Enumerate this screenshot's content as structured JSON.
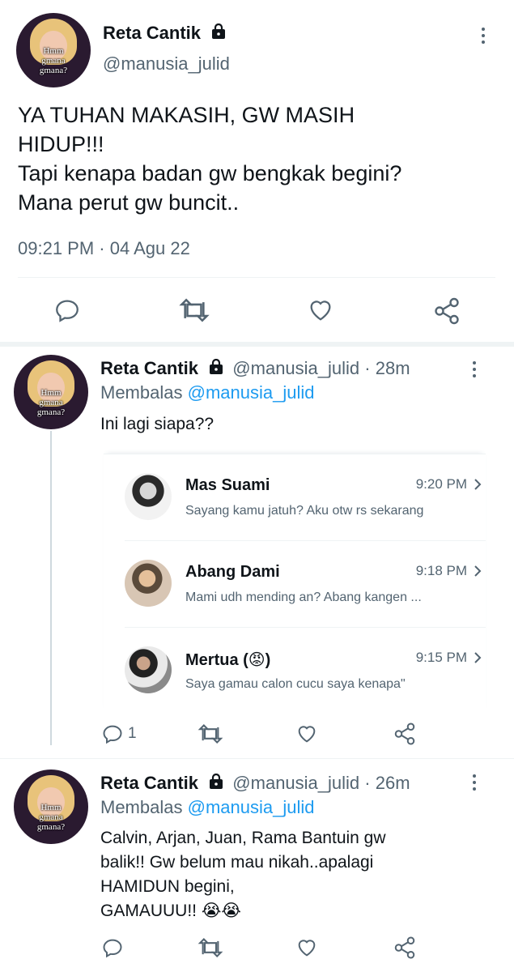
{
  "main_tweet": {
    "author_name": "Reta Cantik",
    "handle": "@manusia_julid",
    "avatar_caption": "Hmm gmana gmana?",
    "text_lines": [
      "YA TUHAN MAKASIH, GW MASIH",
      "HIDUP!!!",
      "Tapi kenapa badan gw bengkak begini?",
      "Mana perut gw buncit.."
    ],
    "timestamp": "09:21 PM · 04 Agu 22"
  },
  "reply1": {
    "author_name": "Reta Cantik",
    "handle": "@manusia_julid",
    "time": "· 28m",
    "replying_label": "Membalas",
    "replying_to": "@manusia_julid",
    "avatar_caption": "Hmm gmana gmana?",
    "text": "Ini lagi siapa??",
    "reply_count": "1",
    "chats": [
      {
        "name": "Mas Suami",
        "time": "9:20 PM",
        "message": "Sayang kamu jatuh? Aku otw rs sekarang"
      },
      {
        "name": "Abang Dami",
        "time": "9:18 PM",
        "message": "Mami udh mending an? Abang kangen ..."
      },
      {
        "name": "Mertua (😡)",
        "time": "9:15 PM",
        "message": "Saya gamau calon cucu saya kenapa\""
      }
    ]
  },
  "reply2": {
    "author_name": "Reta Cantik",
    "handle": "@manusia_julid",
    "time": "· 26m",
    "replying_label": "Membalas",
    "replying_to": "@manusia_julid",
    "avatar_caption": "Hmm gmana gmana?",
    "text_lines": [
      "Calvin, Arjan, Juan, Rama Bantuin gw",
      "balik!! Gw belum mau nikah..apalagi",
      "HAMIDUN begini,",
      "GAMAUUU!! 😭😭"
    ]
  },
  "icons": [
    "lock-icon",
    "more-icon",
    "reply-icon",
    "retweet-icon",
    "like-icon",
    "share-icon",
    "chevron-right-icon"
  ],
  "colors": {
    "accent": "#1d9bf0",
    "muted": "#536471",
    "text": "#0f1419"
  }
}
